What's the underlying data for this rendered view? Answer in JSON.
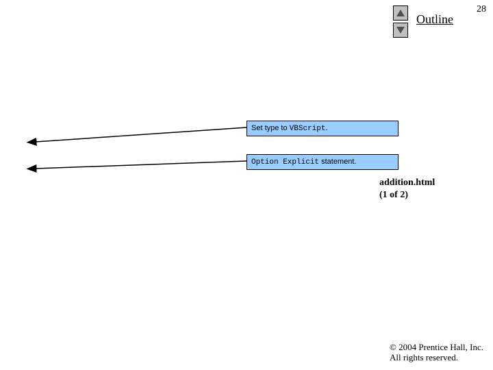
{
  "page_number": "28",
  "outline_title": "Outline",
  "callouts": [
    {
      "prefix": "Set type to ",
      "mono": "VBScript",
      "suffix": "."
    },
    {
      "prefix": "",
      "mono": "Option Explicit",
      "suffix": " statement."
    }
  ],
  "file": {
    "name": "addition.html",
    "page": "(1 of 2)"
  },
  "copyright": {
    "line1": "© 2004 Prentice Hall, Inc.",
    "line2": "All rights reserved."
  }
}
